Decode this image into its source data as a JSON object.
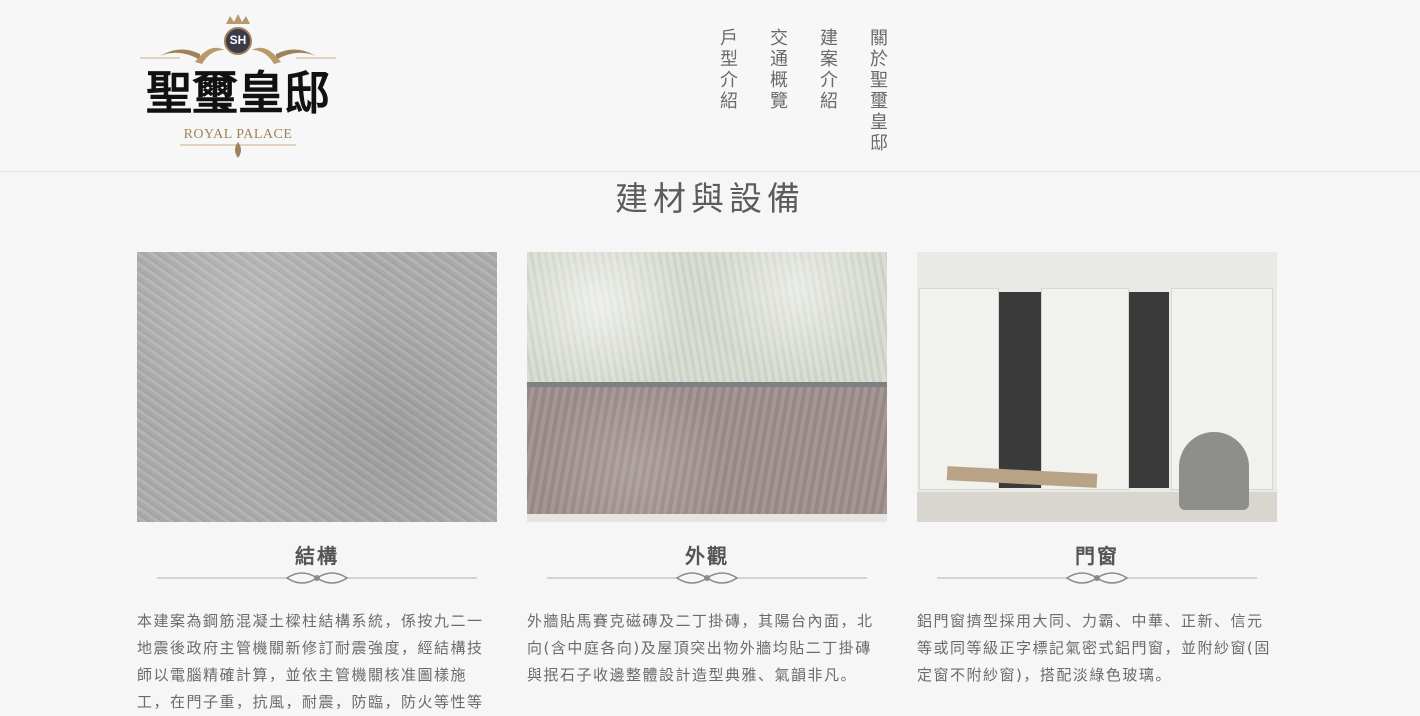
{
  "header": {
    "logo": {
      "monogram": "SH",
      "name_cn": "聖璽皇邸",
      "name_en": "ROYAL PALACE"
    },
    "nav": [
      "戶型介紹",
      "交通概覽",
      "建案介紹",
      "關於聖璽皇邸"
    ]
  },
  "section": {
    "title": "建材與設備",
    "cards": [
      {
        "title": "結構",
        "text": "本建案為鋼筋混凝土樑柱結構系統，係按九二一地震後政府主管機關新修訂耐震強度，經結構技師以電腦精確計算，並依主管機關核准圖樣施工，在門子重，抗風，耐震，防臨，防火等性等"
      },
      {
        "title": "外觀",
        "text": "外牆貼馬賽克磁磚及二丁掛磚，其陽台內面，北向(含中庭各向)及屋頂突出物外牆均貼二丁掛磚與抿石子收邊整體設計造型典雅、氣韻非凡。"
      },
      {
        "title": "門窗",
        "text": "鋁門窗擠型採用大同、力霸、中華、正新、信元等或同等級正字標記氣密式鋁門窗，並附紗窗(固定窗不附紗窗)，搭配淡綠色玻璃。"
      }
    ]
  },
  "colors": {
    "background": "#f6f6f6",
    "gold": "#a0825a",
    "text": "#6b6b6b"
  }
}
